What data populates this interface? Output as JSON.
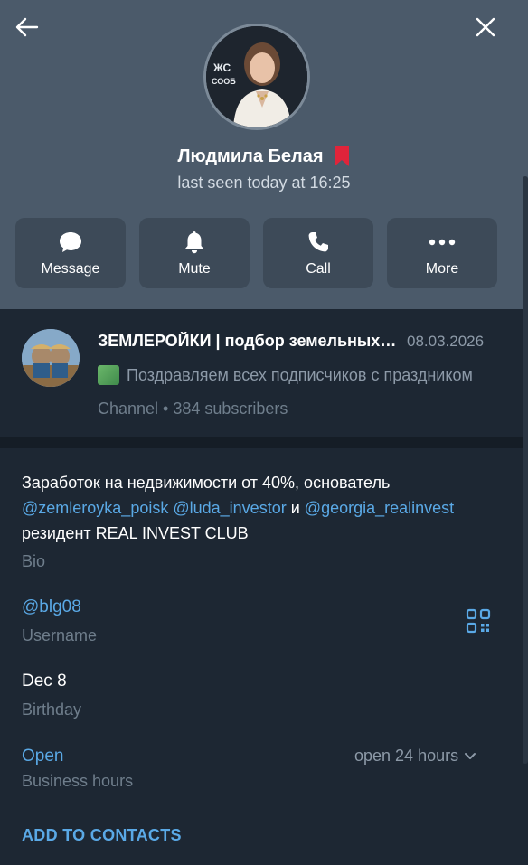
{
  "profile": {
    "name": "Людмила Белая",
    "status": "last seen today at 16:25",
    "avatar_text": "СООБЩЕСТВО"
  },
  "actions": [
    {
      "label": "Message",
      "icon": "message-icon"
    },
    {
      "label": "Mute",
      "icon": "bell-icon"
    },
    {
      "label": "Call",
      "icon": "phone-icon"
    },
    {
      "label": "More",
      "icon": "more-icon"
    }
  ],
  "channel": {
    "title": "ЗЕМЛЕРОЙКИ | подбор земельных участков",
    "date": "08.03.2026",
    "last_message": "Поздравляем всех подписчиков с праздником",
    "subtitle": "Channel • 384 subscribers"
  },
  "bio": {
    "line1": "Заработок на недвижимости от 40%, основатель",
    "link1": "@zemleroyka_poisk",
    "link2": "@luda_investor",
    "conj": "и",
    "link3": "@georgia_realinvest",
    "line3": "резидент REAL INVEST CLUB",
    "label": "Bio"
  },
  "username": {
    "value": "@blg08",
    "label": "Username"
  },
  "birthday": {
    "value": "Dec 8",
    "label": "Birthday"
  },
  "business_hours": {
    "value": "Open",
    "status": "open 24 hours",
    "label": "Business hours"
  },
  "add_contacts_label": "ADD TO CONTACTS",
  "colors": {
    "header_bg": "#4b5a6a",
    "body_bg": "#1d2733",
    "accent": "#5aa9e6",
    "bookmark": "#e0243a"
  }
}
